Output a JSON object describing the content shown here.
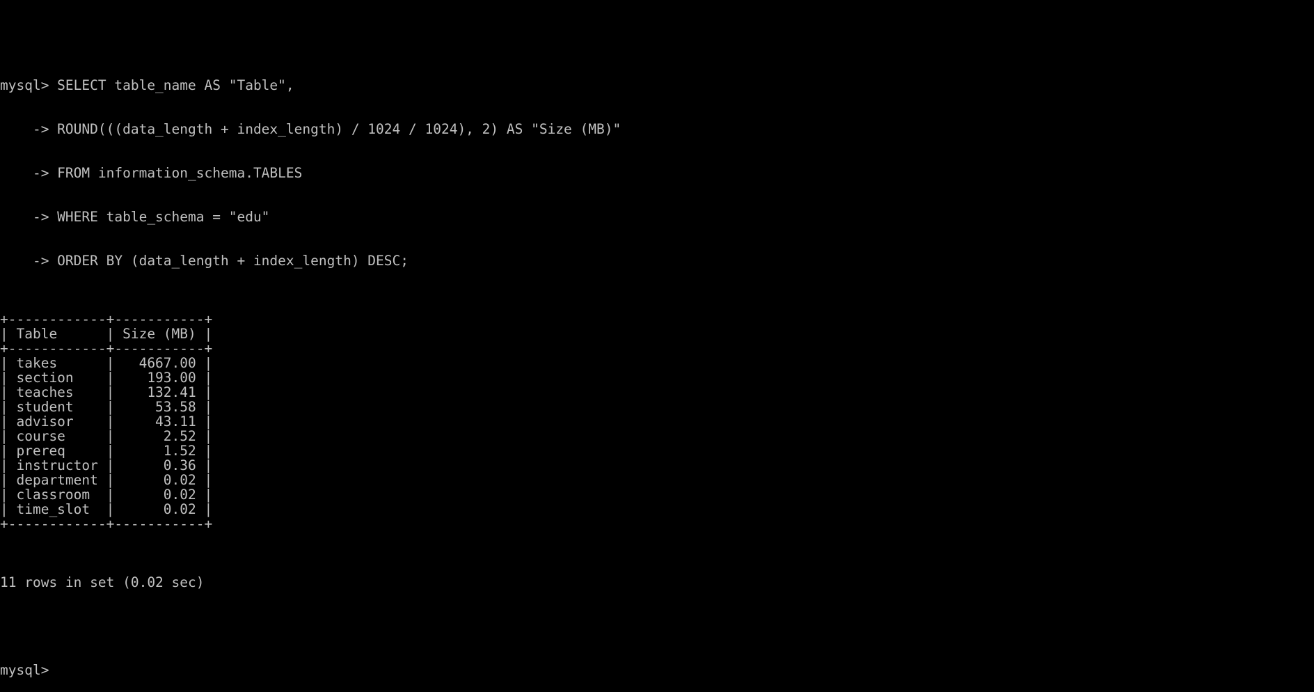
{
  "terminal": {
    "query": {
      "line1": "mysql> SELECT table_name AS \"Table\",",
      "line2": "    -> ROUND(((data_length + index_length) / 1024 / 1024), 2) AS \"Size (MB)\"",
      "line3": "    -> FROM information_schema.TABLES",
      "line4": "    -> WHERE table_schema = \"edu\"",
      "line5": "    -> ORDER BY (data_length + index_length) DESC;"
    },
    "result": {
      "columns": [
        "Table",
        "Size (MB)"
      ],
      "rows": [
        {
          "table": "takes",
          "size": "4667.00"
        },
        {
          "table": "section",
          "size": "193.00"
        },
        {
          "table": "teaches",
          "size": "132.41"
        },
        {
          "table": "student",
          "size": "53.58"
        },
        {
          "table": "advisor",
          "size": "43.11"
        },
        {
          "table": "course",
          "size": "2.52"
        },
        {
          "table": "prereq",
          "size": "1.52"
        },
        {
          "table": "instructor",
          "size": "0.36"
        },
        {
          "table": "department",
          "size": "0.02"
        },
        {
          "table": "classroom",
          "size": "0.02"
        },
        {
          "table": "time_slot",
          "size": "0.02"
        }
      ]
    },
    "summary": "11 rows in set (0.02 sec)",
    "prompt": "mysql> "
  },
  "colors": {
    "background": "#000000",
    "foreground": "#c0c0c0"
  }
}
